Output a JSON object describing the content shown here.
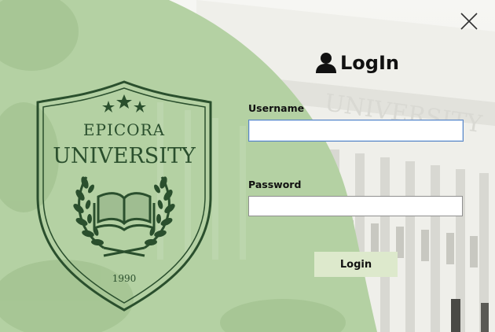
{
  "window": {
    "close_icon": "close-icon"
  },
  "header": {
    "title": "LogIn",
    "icon": "user-icon"
  },
  "form": {
    "username_label": "Username",
    "username_value": "",
    "password_label": "Password",
    "password_value": "",
    "login_button": "Login"
  },
  "logo": {
    "line1": "EPICORA",
    "line2": "UNIVERSITY",
    "year": "1990",
    "icons": [
      "star-icon",
      "book-icon",
      "laurel-icon"
    ]
  },
  "colors": {
    "green_panel": "#b4d1a3",
    "crest_green": "#2a4f2d",
    "button_bg": "#dde9cc",
    "input_focus_border": "#5a86c6"
  }
}
